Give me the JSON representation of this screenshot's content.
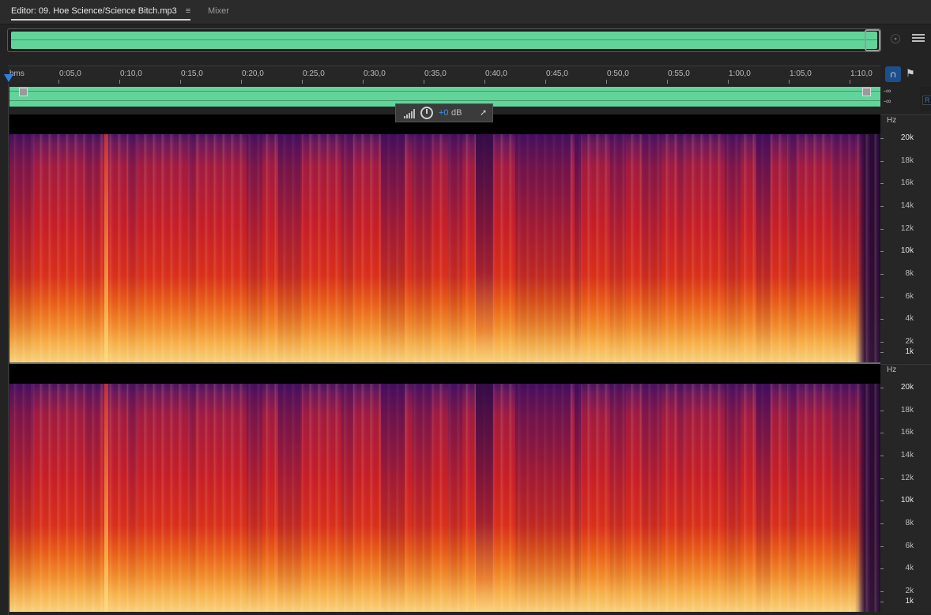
{
  "tabs": {
    "editor_label": "Editor: 09. Hoe Science/Science Bitch.mp3",
    "menu_icon": "hamburger-icon",
    "mixer_label": "Mixer"
  },
  "toolbar": {
    "zoom_icon": "zoom-selection-icon",
    "panel_icon": "panel-menu-icon",
    "snap_icon": "magnet-icon",
    "marker_icon": "marker-icon"
  },
  "ruler": {
    "unit_label": "hms",
    "ticks": [
      "0:05,0",
      "0:10,0",
      "0:15,0",
      "0:20,0",
      "0:25,0",
      "0:30,0",
      "0:35,0",
      "0:40,0",
      "0:45,0",
      "0:50,0",
      "0:55,0",
      "1:00,0",
      "1:05,0",
      "1:10,0"
    ]
  },
  "levels": {
    "left": "-∞",
    "right": "-∞",
    "channel_badge": "R"
  },
  "hud": {
    "value": "+0",
    "unit": "dB"
  },
  "frequency_axis": {
    "unit": "Hz",
    "labels": [
      "20k",
      "18k",
      "16k",
      "14k",
      "12k",
      "10k",
      "8k",
      "6k",
      "4k",
      "2k",
      "1k"
    ]
  },
  "colors": {
    "waveform": "#62d49a",
    "accent": "#2f7fe0",
    "spectrum_low": "#f8d07a",
    "spectrum_mid": "#c51f26",
    "spectrum_high": "#4a155e"
  }
}
